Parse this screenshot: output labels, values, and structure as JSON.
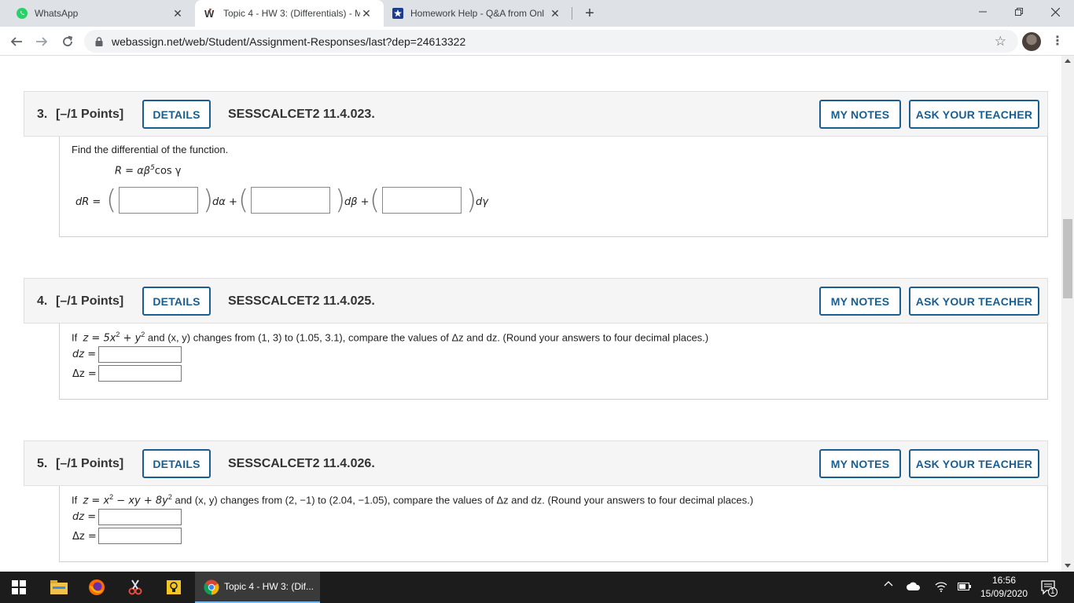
{
  "browser": {
    "tabs": [
      {
        "title": "WhatsApp",
        "active": false
      },
      {
        "title": "Topic 4 - HW 3: (Differentials) - M",
        "active": true
      },
      {
        "title": "Homework Help - Q&A from Onl",
        "active": false
      }
    ],
    "url": "webassign.net/web/Student/Assignment-Responses/last?dep=24613322"
  },
  "buttons": {
    "details": "DETAILS",
    "my_notes": "MY NOTES",
    "ask_teacher": "ASK YOUR TEACHER"
  },
  "questions": [
    {
      "number": "3.",
      "points": "[–/1 Points]",
      "code": "SESSCALCET2 11.4.023.",
      "prompt": "Find the differential of the function.",
      "function_lhs": "R = αβ",
      "function_exp": "5",
      "function_rhs": "cos γ",
      "dR_label": "dR =",
      "d_alpha": "dα +",
      "d_beta": "dβ +",
      "d_gamma": "dγ"
    },
    {
      "number": "4.",
      "points": "[–/1 Points]",
      "code": "SESSCALCET2 11.4.025.",
      "prompt_if": "If",
      "prompt_eq": "z = 5x",
      "prompt_sup1": "2",
      "prompt_plus": " + y",
      "prompt_sup2": "2",
      "prompt_rest": " and  (x, y)  changes from  (1, 3)  to  (1.05, 3.1),  compare the values of Δz and dz. (Round your answers to four decimal places.)",
      "dz_label": "dz =",
      "Dz_label": "Δz ="
    },
    {
      "number": "5.",
      "points": "[–/1 Points]",
      "code": "SESSCALCET2 11.4.026.",
      "prompt_if": "If",
      "prompt_eq": "z = x",
      "prompt_sup1": "2",
      "prompt_mid": " − xy + 8y",
      "prompt_sup2": "2",
      "prompt_rest": " and  (x, y)  changes from  (2, −1)  to  (2.04, −1.05),  compare the values of Δz and dz. (Round your answers to four decimal places.)",
      "dz_label": "dz =",
      "Dz_label": "Δz ="
    }
  ],
  "taskbar": {
    "task_title": "Topic 4 - HW 3: (Dif...",
    "time": "16:56",
    "date": "15/09/2020",
    "notification_count": "1"
  }
}
